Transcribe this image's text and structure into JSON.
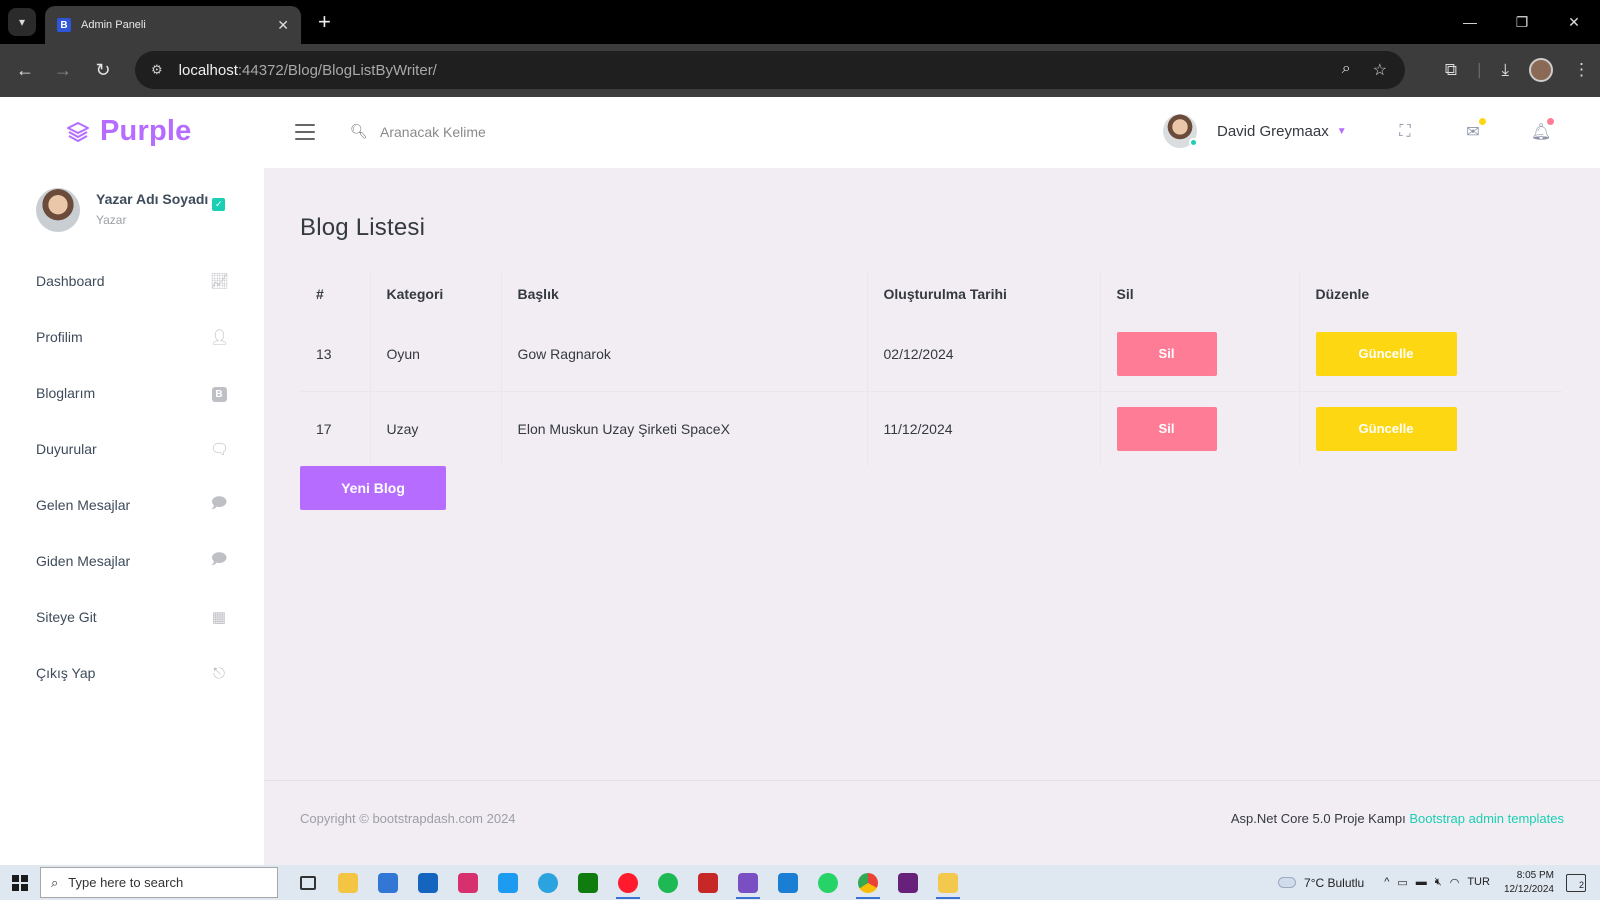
{
  "browser": {
    "tab_title": "Admin Paneli",
    "tab_favicon": "B",
    "url_host": "localhost",
    "url_path": ":44372/Blog/BlogListByWriter/"
  },
  "header": {
    "brand": "Purple",
    "search_placeholder": "Aranacak Kelime",
    "user_name": "David Greymaax"
  },
  "sidebar": {
    "profile_name": "Yazar Adı Soyadı",
    "profile_role": "Yazar",
    "items": [
      {
        "label": "Dashboard",
        "icon": "chart-line-icon"
      },
      {
        "label": "Profilim",
        "icon": "user-icon"
      },
      {
        "label": "Bloglarım",
        "icon": "blog-icon"
      },
      {
        "label": "Duyurular",
        "icon": "announcement-icon"
      },
      {
        "label": "Gelen Mesajlar",
        "icon": "inbox-message-icon"
      },
      {
        "label": "Giden Mesajlar",
        "icon": "outbox-message-icon"
      },
      {
        "label": "Siteye Git",
        "icon": "grid-icon"
      },
      {
        "label": "Çıkış Yap",
        "icon": "logout-icon"
      }
    ]
  },
  "main": {
    "title": "Blog Listesi",
    "columns": [
      "#",
      "Kategori",
      "Başlık",
      "Oluşturulma Tarihi",
      "Sil",
      "Düzenle"
    ],
    "rows": [
      {
        "id": "13",
        "category": "Oyun",
        "title": "Gow Ragnarok",
        "date": "02/12/2024",
        "delete_label": "Sil",
        "edit_label": "Güncelle"
      },
      {
        "id": "17",
        "category": "Uzay",
        "title": "Elon Muskun Uzay Şirketi SpaceX",
        "date": "11/12/2024",
        "delete_label": "Sil",
        "edit_label": "Güncelle"
      }
    ],
    "new_blog_label": "Yeni Blog"
  },
  "footer": {
    "copyright": "Copyright © bootstrapdash.com 2024",
    "right_text": "Asp.Net Core 5.0 Proje Kampı",
    "link_text": "Bootstrap admin templates"
  },
  "taskbar": {
    "search_placeholder": "Type here to search",
    "weather": "7°C  Bulutlu",
    "language": "TUR",
    "time": "8:05 PM",
    "date": "12/12/2024",
    "notification_count": "2"
  },
  "colors": {
    "brand": "#b66dff",
    "danger": "#fe7c96",
    "warning": "#fed713",
    "success": "#1bcfb4"
  }
}
